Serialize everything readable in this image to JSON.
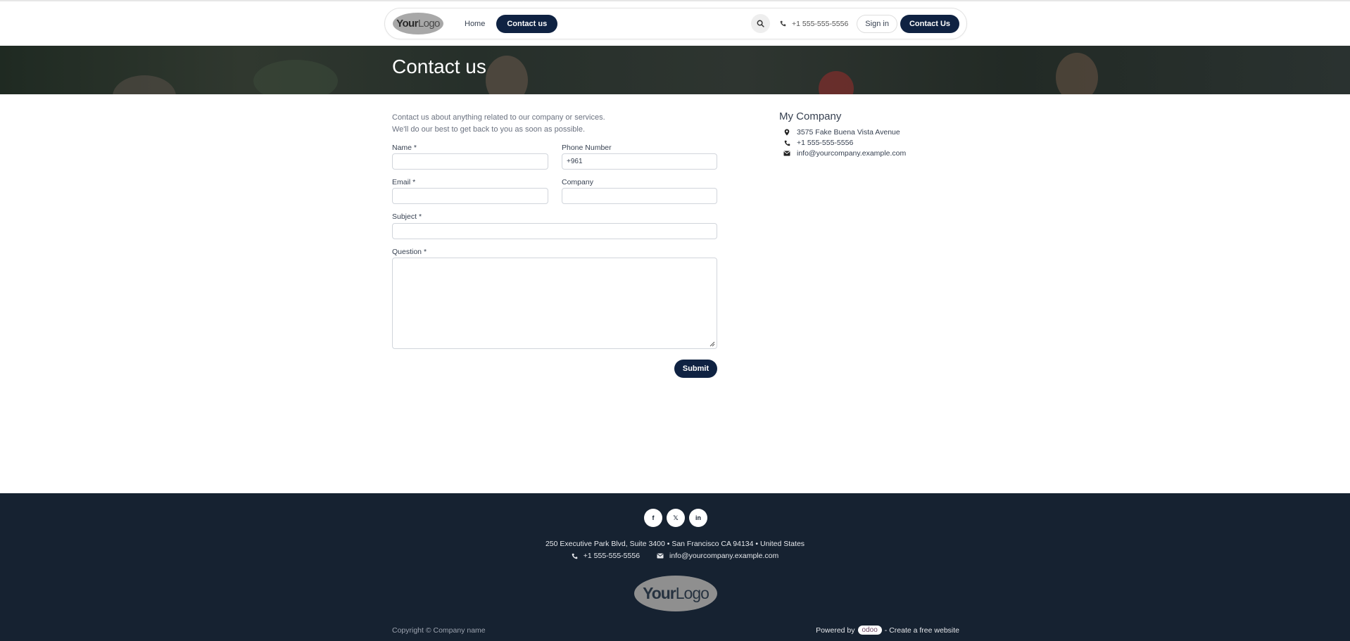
{
  "header": {
    "logo_text_bold": "Your",
    "logo_text_light": "Logo",
    "nav": [
      {
        "label": "Home",
        "active": false
      },
      {
        "label": "Contact us",
        "active": true
      }
    ],
    "phone": "+1 555-555-5556",
    "signin_label": "Sign in",
    "cta_label": "Contact Us"
  },
  "banner": {
    "title": "Contact us"
  },
  "form": {
    "intro_line1": "Contact us about anything related to our company or services.",
    "intro_line2": "We'll do our best to get back to you as soon as possible.",
    "name_label": "Name *",
    "name_value": "",
    "phone_label": "Phone Number",
    "phone_value": "+961",
    "email_label": "Email *",
    "email_value": "",
    "company_label": "Company",
    "company_value": "",
    "subject_label": "Subject *",
    "subject_value": "",
    "question_label": "Question *",
    "question_value": "",
    "submit_label": "Submit"
  },
  "company_info": {
    "title": "My Company",
    "address": "3575 Fake Buena Vista Avenue",
    "phone": "+1 555-555-5556",
    "email": "info@yourcompany.example.com"
  },
  "footer": {
    "socials": [
      {
        "icon": "facebook-icon",
        "glyph": "f"
      },
      {
        "icon": "x-twitter-icon",
        "glyph": "𝕏"
      },
      {
        "icon": "linkedin-icon",
        "glyph": "in"
      }
    ],
    "address": "250 Executive Park Blvd, Suite 3400 • San Francisco CA 94134 • United States",
    "phone": "+1 555-555-5556",
    "email": "info@yourcompany.example.com",
    "logo_text_bold": "Your",
    "logo_text_light": "Logo",
    "copyright": "Copyright © Company name",
    "powered_prefix": "Powered by",
    "powered_brand": "odoo",
    "powered_suffix": "- Create a free website"
  },
  "colors": {
    "primary": "#0f2242",
    "footer_bg": "#162231",
    "text": "#374151"
  }
}
